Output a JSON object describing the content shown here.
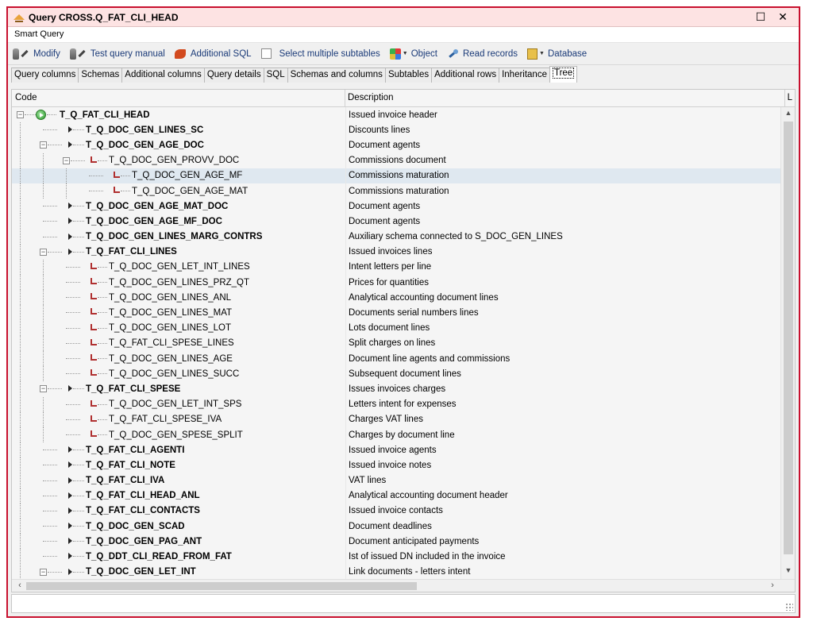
{
  "window": {
    "title": "Query CROSS.Q_FAT_CLI_HEAD",
    "maximize_glyph": "☐",
    "close_glyph": "✕"
  },
  "menu": {
    "label": "Smart Query"
  },
  "toolbar": {
    "modify": "Modify",
    "test_query": "Test query manual",
    "additional_sql": "Additional SQL",
    "select_multiple": "Select multiple subtables",
    "object": "Object",
    "read_records": "Read records",
    "database": "Database"
  },
  "tabs": [
    "Query columns",
    "Schemas",
    "Additional columns",
    "Query details",
    "SQL",
    "Schemas and columns",
    "Subtables",
    "Additional rows",
    "Inheritance",
    "Tree"
  ],
  "grid": {
    "col_code": "Code",
    "col_description": "Description",
    "col_extra": "L"
  },
  "rows": [
    {
      "code": "T_Q_FAT_CLI_HEAD",
      "desc": "Issued invoice header",
      "level": 0,
      "kind": "root",
      "bold": true,
      "expanded": true
    },
    {
      "code": "T_Q_DOC_GEN_LINES_SC",
      "desc": "Discounts lines",
      "level": 1,
      "kind": "arrow",
      "bold": true
    },
    {
      "code": "T_Q_DOC_GEN_AGE_DOC",
      "desc": "Document agents",
      "level": 1,
      "kind": "arrow",
      "bold": true,
      "expanded": true
    },
    {
      "code": "T_Q_DOC_GEN_PROVV_DOC",
      "desc": "Commissions document",
      "level": 2,
      "kind": "link",
      "bold": false,
      "expanded": true
    },
    {
      "code": "T_Q_DOC_GEN_AGE_MF",
      "desc": "Commissions maturation",
      "level": 3,
      "kind": "link",
      "bold": false,
      "selected": true
    },
    {
      "code": "T_Q_DOC_GEN_AGE_MAT",
      "desc": "Commissions maturation",
      "level": 3,
      "kind": "link",
      "bold": false
    },
    {
      "code": "T_Q_DOC_GEN_AGE_MAT_DOC",
      "desc": "Document agents",
      "level": 1,
      "kind": "arrow",
      "bold": true
    },
    {
      "code": "T_Q_DOC_GEN_AGE_MF_DOC",
      "desc": "Document agents",
      "level": 1,
      "kind": "arrow",
      "bold": true
    },
    {
      "code": "T_Q_DOC_GEN_LINES_MARG_CONTRS",
      "desc": "Auxiliary schema connected to S_DOC_GEN_LINES",
      "level": 1,
      "kind": "arrow",
      "bold": true
    },
    {
      "code": "T_Q_FAT_CLI_LINES",
      "desc": "Issued invoices lines",
      "level": 1,
      "kind": "arrow",
      "bold": true,
      "expanded": true
    },
    {
      "code": "T_Q_DOC_GEN_LET_INT_LINES",
      "desc": "Intent letters per line",
      "level": 2,
      "kind": "link",
      "bold": false
    },
    {
      "code": "T_Q_DOC_GEN_LINES_PRZ_QT",
      "desc": "Prices for quantities",
      "level": 2,
      "kind": "link",
      "bold": false
    },
    {
      "code": "T_Q_DOC_GEN_LINES_ANL",
      "desc": "Analytical accounting document lines",
      "level": 2,
      "kind": "link",
      "bold": false
    },
    {
      "code": "T_Q_DOC_GEN_LINES_MAT",
      "desc": "Documents serial numbers lines",
      "level": 2,
      "kind": "link",
      "bold": false
    },
    {
      "code": "T_Q_DOC_GEN_LINES_LOT",
      "desc": "Lots document lines",
      "level": 2,
      "kind": "link",
      "bold": false
    },
    {
      "code": "T_Q_FAT_CLI_SPESE_LINES",
      "desc": "Split charges on lines",
      "level": 2,
      "kind": "link",
      "bold": false
    },
    {
      "code": "T_Q_DOC_GEN_LINES_AGE",
      "desc": "Document line agents and commissions",
      "level": 2,
      "kind": "link",
      "bold": false
    },
    {
      "code": "T_Q_DOC_GEN_LINES_SUCC",
      "desc": "Subsequent document lines",
      "level": 2,
      "kind": "link",
      "bold": false
    },
    {
      "code": "T_Q_FAT_CLI_SPESE",
      "desc": "Issues invoices charges",
      "level": 1,
      "kind": "arrow",
      "bold": true,
      "expanded": true
    },
    {
      "code": "T_Q_DOC_GEN_LET_INT_SPS",
      "desc": "Letters intent for expenses",
      "level": 2,
      "kind": "link",
      "bold": false
    },
    {
      "code": "T_Q_FAT_CLI_SPESE_IVA",
      "desc": "Charges VAT lines",
      "level": 2,
      "kind": "link",
      "bold": false
    },
    {
      "code": "T_Q_DOC_GEN_SPESE_SPLIT",
      "desc": "Charges by document line",
      "level": 2,
      "kind": "link",
      "bold": false
    },
    {
      "code": "T_Q_FAT_CLI_AGENTI",
      "desc": "Issued invoice agents",
      "level": 1,
      "kind": "arrow",
      "bold": true
    },
    {
      "code": "T_Q_FAT_CLI_NOTE",
      "desc": "Issued invoice notes",
      "level": 1,
      "kind": "arrow",
      "bold": true
    },
    {
      "code": "T_Q_FAT_CLI_IVA",
      "desc": "VAT lines",
      "level": 1,
      "kind": "arrow",
      "bold": true
    },
    {
      "code": "T_Q_FAT_CLI_HEAD_ANL",
      "desc": "Analytical accounting document header",
      "level": 1,
      "kind": "arrow",
      "bold": true
    },
    {
      "code": "T_Q_FAT_CLI_CONTACTS",
      "desc": "Issued invoice contacts",
      "level": 1,
      "kind": "arrow",
      "bold": true
    },
    {
      "code": "T_Q_DOC_GEN_SCAD",
      "desc": "Document deadlines",
      "level": 1,
      "kind": "arrow",
      "bold": true
    },
    {
      "code": "T_Q_DOC_GEN_PAG_ANT",
      "desc": "Document anticipated payments",
      "level": 1,
      "kind": "arrow",
      "bold": true
    },
    {
      "code": "T_Q_DDT_CLI_READ_FROM_FAT",
      "desc": "Ist of issued DN included in the invoice",
      "level": 1,
      "kind": "arrow",
      "bold": true
    },
    {
      "code": "T_Q_DOC_GEN_LET_INT",
      "desc": "Link documents - letters intent",
      "level": 1,
      "kind": "arrow",
      "bold": true,
      "expanded": true
    }
  ]
}
